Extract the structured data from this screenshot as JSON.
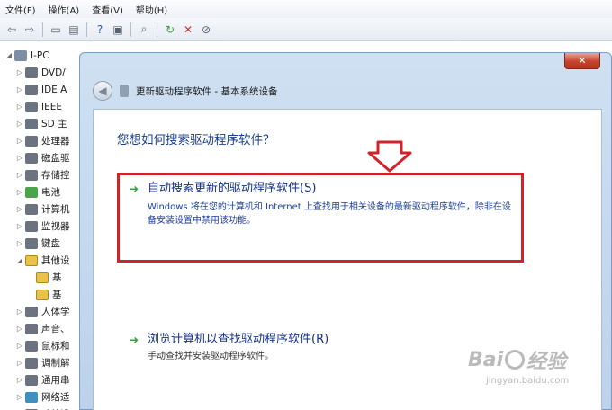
{
  "background_window": {
    "menu": [
      "文件(F)",
      "操作(A)",
      "查看(V)",
      "帮助(H)"
    ],
    "toolbar_icons": [
      "back-arrow-icon",
      "forward-arrow-icon",
      "console-tree-icon",
      "properties-icon",
      "help-icon",
      "view-icon",
      "scan-hardware-icon",
      "update-driver-icon",
      "uninstall-icon",
      "disable-icon"
    ],
    "tree": [
      {
        "label": "I-PC",
        "level": 0,
        "arrow": "◢",
        "icon": "root"
      },
      {
        "label": "DVD/",
        "level": 1,
        "arrow": "▷",
        "icon": "dev"
      },
      {
        "label": "IDE A",
        "level": 1,
        "arrow": "▷",
        "icon": "dev"
      },
      {
        "label": "IEEE",
        "level": 1,
        "arrow": "▷",
        "icon": "dev"
      },
      {
        "label": "SD 主",
        "level": 1,
        "arrow": "▷",
        "icon": "dev"
      },
      {
        "label": "处理器",
        "level": 1,
        "arrow": "▷",
        "icon": "dev"
      },
      {
        "label": "磁盘驱",
        "level": 1,
        "arrow": "▷",
        "icon": "dev"
      },
      {
        "label": "存储控",
        "level": 1,
        "arrow": "▷",
        "icon": "dev"
      },
      {
        "label": "电池",
        "level": 1,
        "arrow": "▷",
        "icon": "bat"
      },
      {
        "label": "计算机",
        "level": 1,
        "arrow": "▷",
        "icon": "dev"
      },
      {
        "label": "监视器",
        "level": 1,
        "arrow": "▷",
        "icon": "dev"
      },
      {
        "label": "键盘",
        "level": 1,
        "arrow": "▷",
        "icon": "dev"
      },
      {
        "label": "其他设",
        "level": 1,
        "arrow": "◢",
        "icon": "warn"
      },
      {
        "label": "基",
        "level": 2,
        "arrow": "",
        "icon": "warn"
      },
      {
        "label": "基",
        "level": 2,
        "arrow": "",
        "icon": "warn"
      },
      {
        "label": "人体学",
        "level": 1,
        "arrow": "▷",
        "icon": "dev"
      },
      {
        "label": "声音、",
        "level": 1,
        "arrow": "▷",
        "icon": "dev"
      },
      {
        "label": "鼠标和",
        "level": 1,
        "arrow": "▷",
        "icon": "dev"
      },
      {
        "label": "调制解",
        "level": 1,
        "arrow": "▷",
        "icon": "dev"
      },
      {
        "label": "通用串",
        "level": 1,
        "arrow": "▷",
        "icon": "dev"
      },
      {
        "label": "网络适",
        "level": 1,
        "arrow": "▷",
        "icon": "net"
      },
      {
        "label": "系统设",
        "level": 1,
        "arrow": "▷",
        "icon": "dev"
      }
    ]
  },
  "dialog": {
    "title": "更新驱动程序软件 - 基本系统设备",
    "close_label": "✕",
    "back_label": "◀",
    "question": "您想如何搜索驱动程序软件？",
    "options": {
      "auto": {
        "title": "自动搜索更新的驱动程序软件(S)",
        "description": "Windows 将在您的计算机和 Internet 上查找用于相关设备的最新驱动程序软件，除非在设备安装设置中禁用该功能。"
      },
      "browse": {
        "title": "浏览计算机以查找驱动程序软件(R)",
        "description": "手动查找并安装驱动程序软件。"
      }
    },
    "option_icon": "➜"
  },
  "watermark": {
    "brand_left": "Bai",
    "brand_right": "经验",
    "url": "jingyan.baidu.com"
  },
  "colors": {
    "highlight_border": "#d2232b",
    "question_text": "#1a3e8c",
    "link_text": "#13308a",
    "go_arrow": "#3a9c3a"
  }
}
